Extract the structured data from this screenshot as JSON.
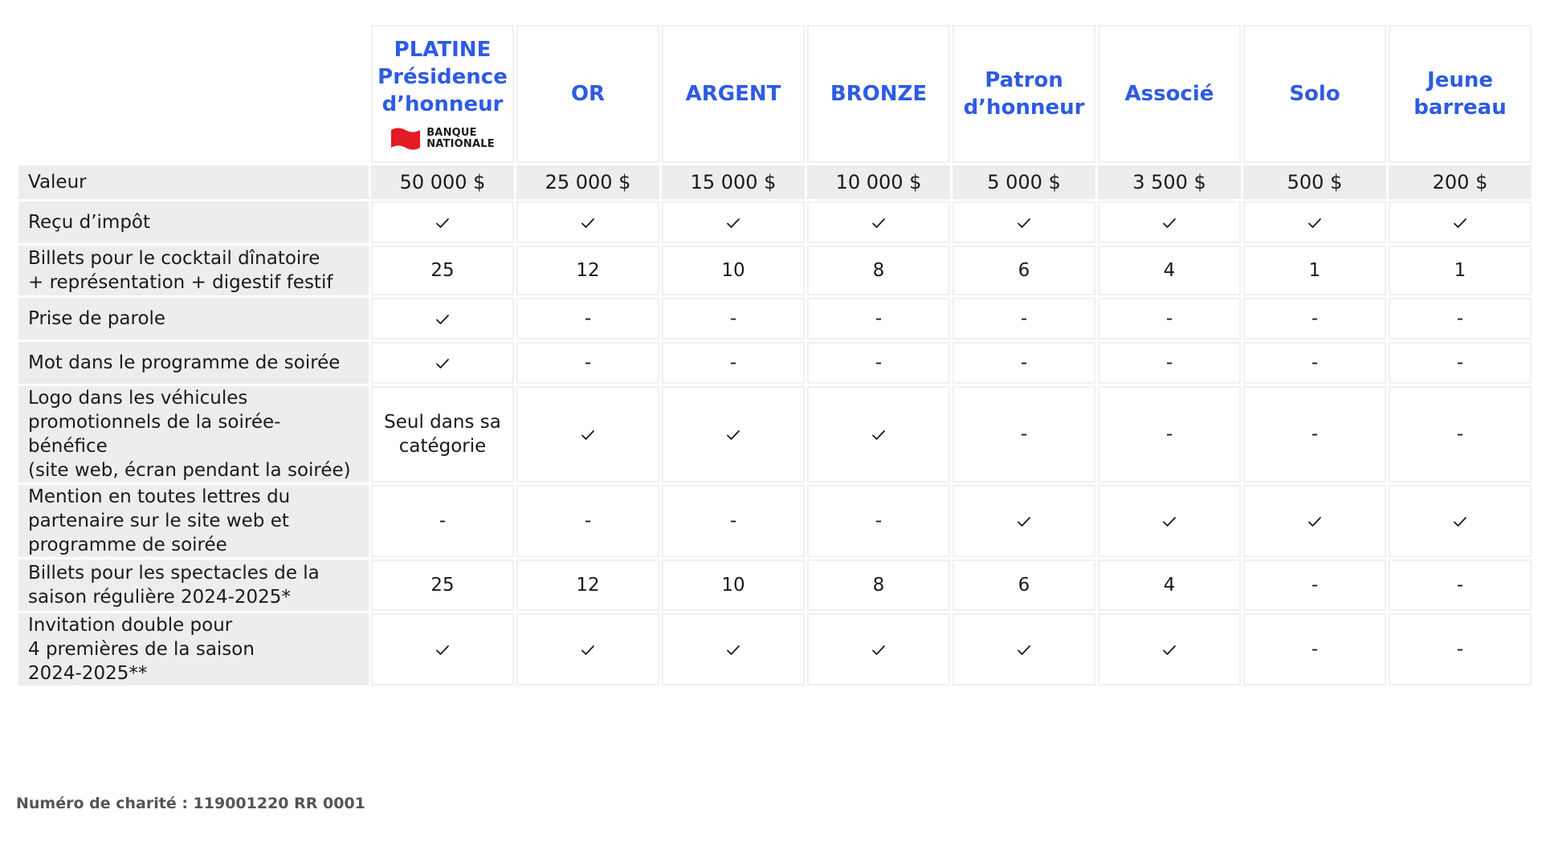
{
  "tiers": [
    {
      "key": "platine",
      "lines": [
        "PLATINE",
        "Présidence",
        "d’honneur"
      ],
      "sponsor": {
        "lines": [
          "BANQUE",
          "NATIONALE"
        ],
        "brand_color": "#e31b23"
      }
    },
    {
      "key": "or",
      "lines": [
        "OR"
      ]
    },
    {
      "key": "argent",
      "lines": [
        "ARGENT"
      ]
    },
    {
      "key": "bronze",
      "lines": [
        "BRONZE"
      ]
    },
    {
      "key": "patron",
      "lines": [
        "Patron",
        "d’honneur"
      ]
    },
    {
      "key": "associe",
      "lines": [
        "Associé"
      ]
    },
    {
      "key": "solo",
      "lines": [
        "Solo"
      ]
    },
    {
      "key": "jeune",
      "lines": [
        "Jeune",
        "barreau"
      ]
    }
  ],
  "rows": [
    {
      "key": "valeur",
      "label": [
        "Valeur"
      ],
      "values": [
        "50 000 $",
        "25 000 $",
        "15 000 $",
        "10 000 $",
        "5 000 $",
        "3 500 $",
        "500 $",
        "200 $"
      ]
    },
    {
      "key": "recu",
      "label": [
        "Reçu d’impôt"
      ],
      "values": [
        "check",
        "check",
        "check",
        "check",
        "check",
        "check",
        "check",
        "check"
      ]
    },
    {
      "key": "billets-cocktail",
      "label": [
        "Billets pour le cocktail dînatoire",
        "+ représentation + digestif festif"
      ],
      "values": [
        "25",
        "12",
        "10",
        "8",
        "6",
        "4",
        "1",
        "1"
      ]
    },
    {
      "key": "prise-parole",
      "label": [
        "Prise de parole"
      ],
      "values": [
        "check",
        "-",
        "-",
        "-",
        "-",
        "-",
        "-",
        "-"
      ]
    },
    {
      "key": "mot-programme",
      "label": [
        "Mot dans le programme de soirée"
      ],
      "values": [
        "check",
        "-",
        "-",
        "-",
        "-",
        "-",
        "-",
        "-"
      ]
    },
    {
      "key": "logo-vehicules",
      "label": [
        "Logo dans les véhicules",
        "promotionnels de la soirée-bénéfice",
        "(site web, écran pendant la soirée)"
      ],
      "values": [
        [
          "Seul dans sa",
          "catégorie"
        ],
        "check",
        "check",
        "check",
        "-",
        "-",
        "-",
        "-"
      ]
    },
    {
      "key": "mention",
      "label": [
        "Mention en toutes lettres du",
        "partenaire sur le site web et",
        "programme de soirée"
      ],
      "values": [
        "-",
        "-",
        "-",
        "-",
        "check",
        "check",
        "check",
        "check"
      ]
    },
    {
      "key": "billets-saison",
      "label": [
        "Billets pour les spectacles de la",
        "saison régulière 2024-2025*"
      ],
      "values": [
        "25",
        "12",
        "10",
        "8",
        "6",
        "4",
        "-",
        "-"
      ]
    },
    {
      "key": "invitation",
      "label": [
        "Invitation double pour",
        "4 premières de la saison",
        "2024-2025**"
      ],
      "values": [
        "check",
        "check",
        "check",
        "check",
        "check",
        "check",
        "-",
        "-"
      ]
    }
  ],
  "footer": {
    "charity_number": "Numéro de charité : 119001220 RR 0001"
  },
  "colors": {
    "header_text": "#2d5be3",
    "label_bg": "#ededed",
    "text": "#1a1a1a"
  }
}
